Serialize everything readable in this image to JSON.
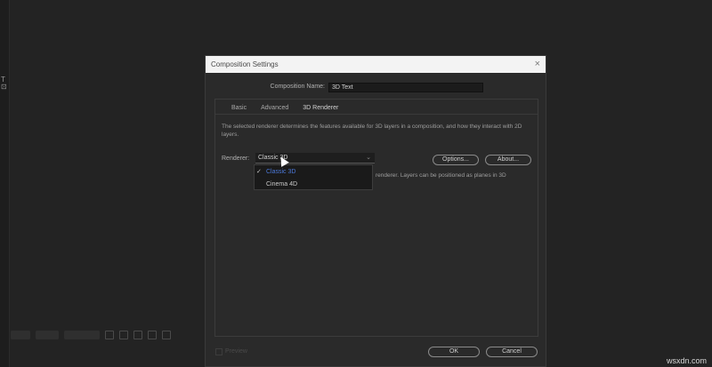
{
  "dialog": {
    "title": "Composition Settings",
    "close_glyph": "×",
    "composition_name_label": "Composition Name:",
    "composition_name_value": "3D Text",
    "tabs": [
      {
        "label": "Basic",
        "active": false
      },
      {
        "label": "Advanced",
        "active": false
      },
      {
        "label": "3D Renderer",
        "active": true
      }
    ],
    "description": "The selected renderer determines the features available for 3D layers in a composition, and how they interact with 2D layers.",
    "renderer_label": "Renderer:",
    "renderer_value": "Classic 3D",
    "options_button": "Options...",
    "about_button": "About...",
    "info_tail": "renderer. Layers can be positioned as planes in 3D",
    "dropdown_items": [
      {
        "label": "Classic 3D",
        "checked": true
      },
      {
        "label": "Cinema 4D",
        "checked": false
      }
    ],
    "preview_label": "Preview",
    "ok_button": "OK",
    "cancel_button": "Cancel"
  },
  "background": {
    "left_glyph": "T\n⊡"
  },
  "watermark": "wsxdn.com",
  "colors": {
    "accent_selected": "#4b78d8",
    "dialog_bg": "#2a2a2a",
    "titlebar_bg": "#f3f3f3"
  }
}
